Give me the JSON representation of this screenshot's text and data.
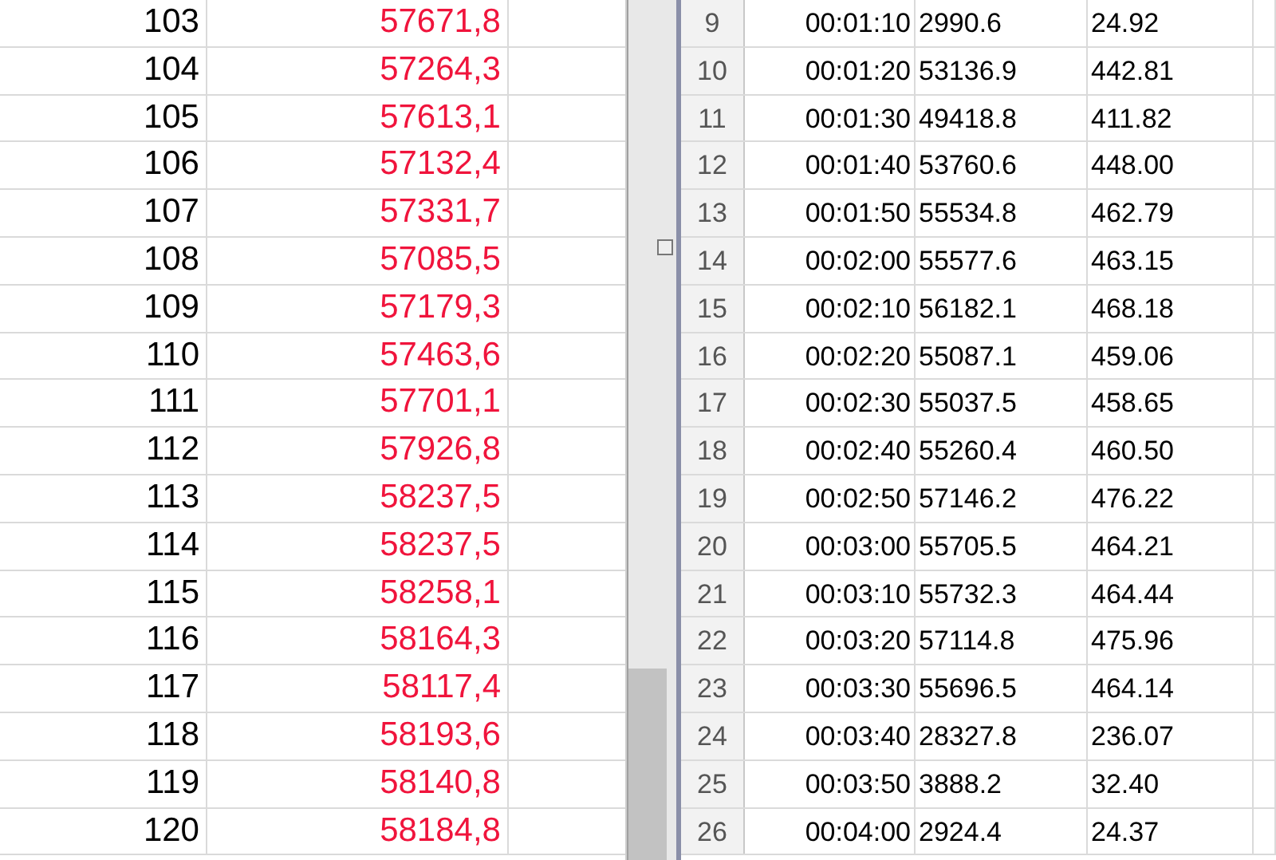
{
  "left_sheet": {
    "rows": [
      {
        "column_1": "103",
        "column_2": "57671,8"
      },
      {
        "column_1": "104",
        "column_2": "57264,3"
      },
      {
        "column_1": "105",
        "column_2": "57613,1"
      },
      {
        "column_1": "106",
        "column_2": "57132,4"
      },
      {
        "column_1": "107",
        "column_2": "57331,7"
      },
      {
        "column_1": "108",
        "column_2": "57085,5"
      },
      {
        "column_1": "109",
        "column_2": "57179,3"
      },
      {
        "column_1": "110",
        "column_2": "57463,6"
      },
      {
        "column_1": "111",
        "column_2": "57701,1"
      },
      {
        "column_1": "112",
        "column_2": "57926,8"
      },
      {
        "column_1": "113",
        "column_2": "58237,5"
      },
      {
        "column_1": "114",
        "column_2": "58237,5"
      },
      {
        "column_1": "115",
        "column_2": "58258,1"
      },
      {
        "column_1": "116",
        "column_2": "58164,3"
      },
      {
        "column_1": "117",
        "column_2": "58117,4"
      },
      {
        "column_1": "118",
        "column_2": "58193,6"
      },
      {
        "column_1": "119",
        "column_2": "58140,8"
      },
      {
        "column_1": "120",
        "column_2": "58184,8"
      }
    ]
  },
  "right_sheet": {
    "rows": [
      {
        "row_number": "9",
        "column_1": "00:01:10",
        "column_2": "2990.6",
        "column_3": "24.92"
      },
      {
        "row_number": "10",
        "column_1": "00:01:20",
        "column_2": "53136.9",
        "column_3": "442.81"
      },
      {
        "row_number": "11",
        "column_1": "00:01:30",
        "column_2": "49418.8",
        "column_3": "411.82"
      },
      {
        "row_number": "12",
        "column_1": "00:01:40",
        "column_2": "53760.6",
        "column_3": "448.00"
      },
      {
        "row_number": "13",
        "column_1": "00:01:50",
        "column_2": "55534.8",
        "column_3": "462.79"
      },
      {
        "row_number": "14",
        "column_1": "00:02:00",
        "column_2": "55577.6",
        "column_3": "463.15"
      },
      {
        "row_number": "15",
        "column_1": "00:02:10",
        "column_2": "56182.1",
        "column_3": "468.18"
      },
      {
        "row_number": "16",
        "column_1": "00:02:20",
        "column_2": "55087.1",
        "column_3": "459.06"
      },
      {
        "row_number": "17",
        "column_1": "00:02:30",
        "column_2": "55037.5",
        "column_3": "458.65"
      },
      {
        "row_number": "18",
        "column_1": "00:02:40",
        "column_2": "55260.4",
        "column_3": "460.50"
      },
      {
        "row_number": "19",
        "column_1": "00:02:50",
        "column_2": "57146.2",
        "column_3": "476.22"
      },
      {
        "row_number": "20",
        "column_1": "00:03:00",
        "column_2": "55705.5",
        "column_3": "464.21"
      },
      {
        "row_number": "21",
        "column_1": "00:03:10",
        "column_2": "55732.3",
        "column_3": "464.44"
      },
      {
        "row_number": "22",
        "column_1": "00:03:20",
        "column_2": "57114.8",
        "column_3": "475.96"
      },
      {
        "row_number": "23",
        "column_1": "00:03:30",
        "column_2": "55696.5",
        "column_3": "464.14"
      },
      {
        "row_number": "24",
        "column_1": "00:03:40",
        "column_2": "28327.8",
        "column_3": "236.07"
      },
      {
        "row_number": "25",
        "column_1": "00:03:50",
        "column_2": "3888.2",
        "column_3": "32.40"
      },
      {
        "row_number": "26",
        "column_1": "00:04:00",
        "column_2": "2924.4",
        "column_3": "24.37"
      }
    ]
  }
}
